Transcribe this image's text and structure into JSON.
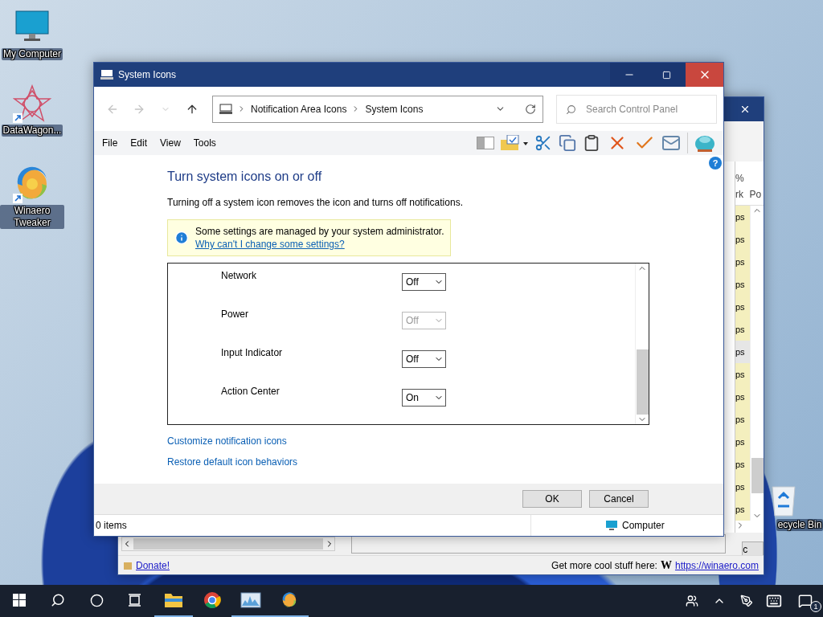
{
  "desktop_icons": [
    {
      "label": "My Computer",
      "kind": "computer",
      "shortcut": false
    },
    {
      "label": "DataWagon...",
      "kind": "star",
      "shortcut": true
    },
    {
      "label": "Winaero Tweaker",
      "kind": "swirl",
      "shortcut": true
    }
  ],
  "recycle_bin": {
    "label": "ecycle Bin"
  },
  "background_window": {
    "columns": [
      {
        "lines": [
          "%",
          "rk"
        ]
      },
      {
        "lines": [
          "Po"
        ]
      }
    ],
    "rows": [
      {
        "cell": "ps",
        "selected": false
      },
      {
        "cell": "ps",
        "selected": false
      },
      {
        "cell": "ps",
        "selected": false
      },
      {
        "cell": "ps",
        "selected": false
      },
      {
        "cell": "ps",
        "selected": false
      },
      {
        "cell": "ps",
        "selected": false
      },
      {
        "cell": "ps",
        "selected": true
      },
      {
        "cell": "ps",
        "selected": false
      },
      {
        "cell": "ps",
        "selected": false
      },
      {
        "cell": "ps",
        "selected": false
      },
      {
        "cell": "ps",
        "selected": false
      },
      {
        "cell": "ps",
        "selected": false
      },
      {
        "cell": "ps",
        "selected": false
      },
      {
        "cell": "ps",
        "selected": false
      }
    ],
    "bottom_button": "c",
    "donate_link": "Donate!",
    "promo_text": "Get more cool stuff here:",
    "promo_logo": "W",
    "promo_link": "https://winaero.com"
  },
  "window": {
    "title": "System Icons",
    "breadcrumb": [
      "Notification Area Icons",
      "System Icons"
    ],
    "search": {
      "placeholder": "Search Control Panel"
    },
    "menu": [
      "File",
      "Edit",
      "View",
      "Tools"
    ],
    "help": "?",
    "heading": "Turn system icons on or off",
    "description": "Turning off a system icon removes the icon and turns off notifications.",
    "notice": {
      "text": "Some settings are managed by your system administrator.",
      "link": "Why can't I change some settings?"
    },
    "settings": [
      {
        "label": "Network",
        "value": "Off",
        "disabled": false
      },
      {
        "label": "Power",
        "value": "Off",
        "disabled": true
      },
      {
        "label": "Input Indicator",
        "value": "Off",
        "disabled": false
      },
      {
        "label": "Action Center",
        "value": "On",
        "disabled": false
      }
    ],
    "links": [
      "Customize notification icons",
      "Restore default icon behaviors"
    ],
    "buttons": [
      "OK",
      "Cancel"
    ],
    "status_bar": {
      "items": "0 items",
      "location": "Computer"
    }
  },
  "taskbar": {
    "apps": [
      {
        "kind": "explorer",
        "running": true
      },
      {
        "kind": "chrome",
        "running": false
      },
      {
        "kind": "monitor",
        "running": true
      },
      {
        "kind": "winaero",
        "running": true
      }
    ],
    "notification_badge": "1"
  }
}
